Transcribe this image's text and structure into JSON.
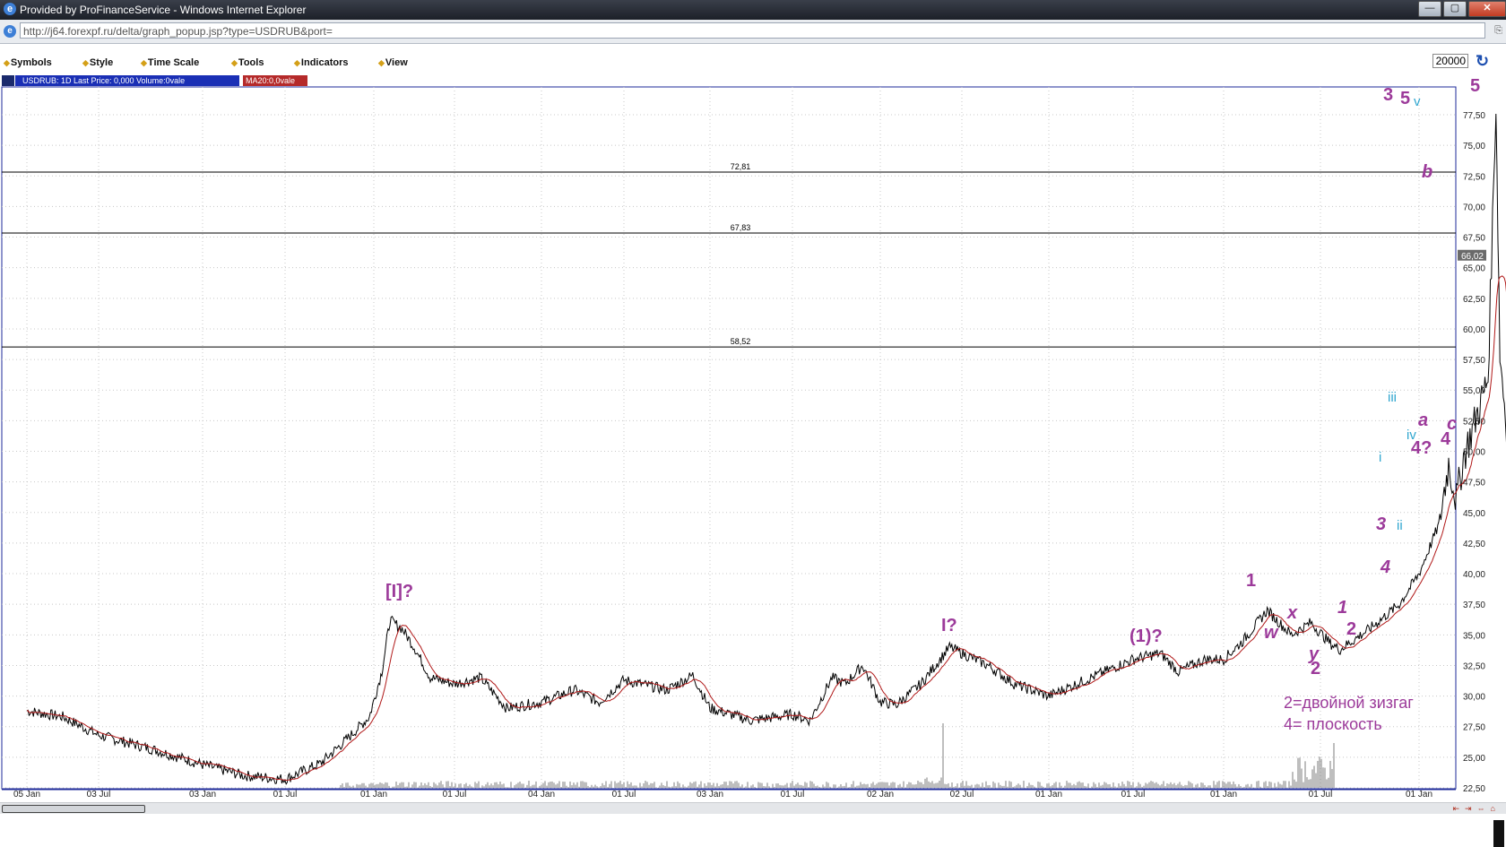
{
  "window": {
    "title": "Provided by ProFinanceService - Windows Internet Explorer",
    "buttons": {
      "minimize": "—",
      "maximize": "▢",
      "close": "✕"
    }
  },
  "address": {
    "url": "http://j64.forexpf.ru/delta/graph_popup.jsp?type=USDRUB&port="
  },
  "menu": {
    "items": [
      "Symbols",
      "Style",
      "Time Scale",
      "Tools",
      "Indicators",
      "View"
    ],
    "period_value": "20000"
  },
  "info": {
    "main": "USDRUB: 1D  Last Price: 0,000  Volume:0vale",
    "ma": "MA20:0,0vale"
  },
  "colors": {
    "price": "#000000",
    "ma": "#b01818",
    "volume": "#a8a8a8",
    "wave": "#9c3a9a",
    "subwave": "#2fa6cf"
  },
  "icons": {
    "ie": "e",
    "refresh": "↻",
    "page": "⎘"
  },
  "chart_data": {
    "type": "line",
    "symbol": "USDRUB",
    "ylim": [
      22.5,
      80
    ],
    "y_ticks": [
      "22,50",
      "25,00",
      "27,50",
      "30,00",
      "32,50",
      "35,00",
      "37,50",
      "40,00",
      "42,50",
      "45,00",
      "47,50",
      "50,00",
      "52,50",
      "55,00",
      "57,50",
      "60,00",
      "62,50",
      "65,00",
      "67,50",
      "70,00",
      "72,50",
      "75,00",
      "77,50"
    ],
    "x_tick_labels": [
      "05 Jan",
      "03 Jul",
      "03 Jan",
      "01 Jul",
      "01 Jan",
      "01 Jul",
      "04 Jan",
      "01 Jul",
      "03 Jan",
      "01 Jul",
      "02 Jan",
      "02 Jul",
      "01 Jan",
      "01 Jul",
      "01 Jan",
      "01 Jul",
      "01 Jan"
    ],
    "current_price_label": "66,02",
    "horizontal_levels": [
      {
        "value": 72.81,
        "label": "72,81"
      },
      {
        "value": 67.83,
        "label": "67,83"
      },
      {
        "value": 58.52,
        "label": "58,52"
      }
    ],
    "series": [
      {
        "x": [
          "05 Jan",
          "03 Jul",
          "03 Jan",
          "01 Jul",
          "01 Jan",
          "01 Jul",
          "04 Jan",
          "01 Jul",
          "03 Jan",
          "01 Jul",
          "02 Jan",
          "02 Jul",
          "01 Jan",
          "01 Jul",
          "01 Jan",
          "01 Jul",
          "01 Jan"
        ],
        "values": [
          28.8,
          26.8,
          24.4,
          23.2,
          28.5,
          31,
          29.5,
          31.3,
          29,
          28.5,
          29.5,
          33.5,
          30,
          33,
          33,
          34.5,
          66
        ],
        "kind": "price"
      }
    ],
    "annotations": [
      {
        "text": "[I]?",
        "style": "wave"
      },
      {
        "text": "I?",
        "style": "wave"
      },
      {
        "text": "(1)?",
        "style": "wave"
      },
      {
        "text": "1",
        "style": "wave"
      },
      {
        "text": "w",
        "style": "wave"
      },
      {
        "text": "x",
        "style": "wave"
      },
      {
        "text": "y",
        "style": "wave"
      },
      {
        "text": "2",
        "style": "wave"
      },
      {
        "text": "1",
        "style": "wave"
      },
      {
        "text": "2",
        "style": "wave"
      },
      {
        "text": "4",
        "style": "wave"
      },
      {
        "text": "3",
        "style": "wave"
      },
      {
        "text": "ii",
        "style": "subwave"
      },
      {
        "text": "i",
        "style": "subwave"
      },
      {
        "text": "iii",
        "style": "subwave"
      },
      {
        "text": "iv",
        "style": "subwave"
      },
      {
        "text": "4?",
        "style": "wave"
      },
      {
        "text": "a",
        "style": "wave"
      },
      {
        "text": "c",
        "style": "wave"
      },
      {
        "text": "4",
        "style": "wave"
      },
      {
        "text": "b",
        "style": "wave"
      },
      {
        "text": "3",
        "style": "wave"
      },
      {
        "text": "5",
        "style": "wave"
      },
      {
        "text": "v",
        "style": "subwave"
      },
      {
        "text": "5",
        "style": "wave"
      },
      {
        "text": "2=двойной зизгаг",
        "style": "note"
      },
      {
        "text": "4= плоскость",
        "style": "note"
      }
    ]
  }
}
